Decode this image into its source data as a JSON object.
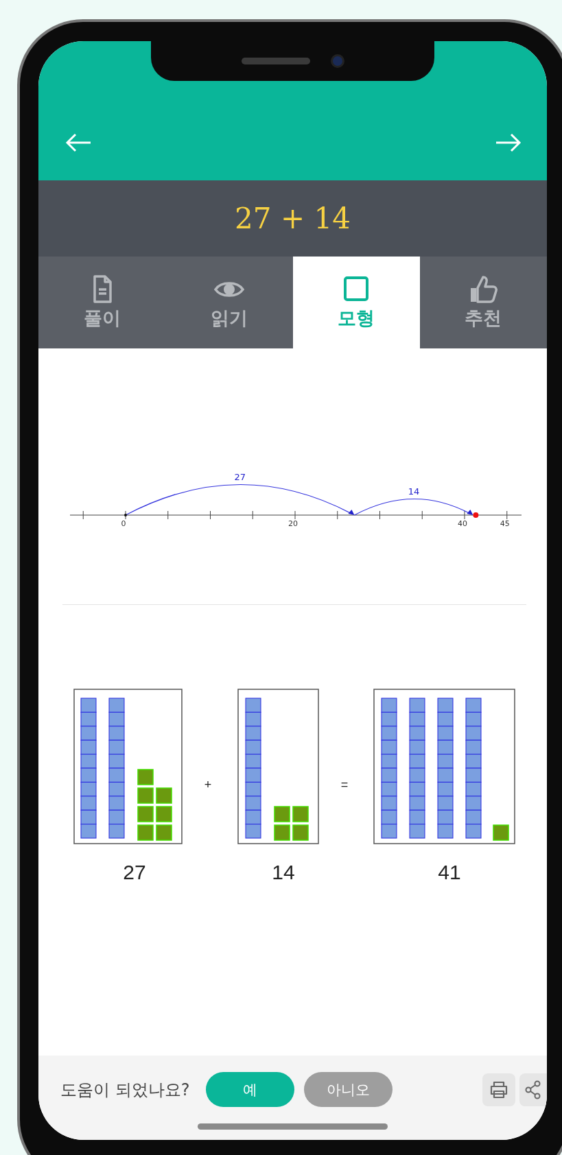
{
  "problem": {
    "expression": "27 + 14"
  },
  "tabs": [
    {
      "label": "풀이",
      "kind": "document",
      "selected": false
    },
    {
      "label": "읽기",
      "kind": "eye",
      "selected": false
    },
    {
      "label": "모형",
      "kind": "square",
      "selected": true
    },
    {
      "label": "추천",
      "kind": "thumb",
      "selected": false
    }
  ],
  "number_line": {
    "tick_labels": [
      "0",
      "20",
      "40",
      "45"
    ],
    "jumps": [
      "27",
      "14"
    ]
  },
  "blocks": {
    "groups": [
      "27",
      "14",
      "41"
    ],
    "operators": [
      "+",
      "="
    ]
  },
  "feedback": {
    "question": "도움이 되었나요?",
    "buttons": [
      {
        "label": "예",
        "kind": "primary"
      },
      {
        "label": "아니오",
        "kind": "secondary"
      }
    ]
  }
}
